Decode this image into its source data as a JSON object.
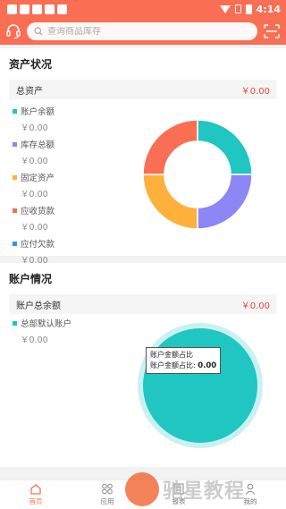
{
  "status": {
    "time": "4:14"
  },
  "search": {
    "placeholder": "查询商品库存"
  },
  "assets": {
    "title": "资产状况",
    "total_label": "总资产",
    "total_value": "￥0.00",
    "items": [
      {
        "label": "账户余额",
        "value": "￥0.00",
        "color": "#1fc6c2"
      },
      {
        "label": "库存总额",
        "value": "￥0.00",
        "color": "#8c87f5"
      },
      {
        "label": "固定资产",
        "value": "￥0.00",
        "color": "#fdb13a"
      },
      {
        "label": "应收货款",
        "value": "￥0.00",
        "color": "#fa6e53"
      },
      {
        "label": "应付欠款",
        "value": "￥0.00",
        "color": "#3b8fe5"
      }
    ]
  },
  "accounts": {
    "title": "账户情况",
    "total_label": "账户总余额",
    "total_value": "￥0.00",
    "items": [
      {
        "label": "总部默认账户",
        "value": "￥0.00",
        "color": "#1fc6c2"
      }
    ],
    "tooltip": {
      "title": "账户金额占比",
      "label": "账户金额占比:",
      "value": "0.00"
    }
  },
  "chart_data": [
    {
      "type": "pie",
      "categories": [
        "账户余额",
        "库存总额",
        "固定资产",
        "应收货款"
      ],
      "values": [
        25,
        25,
        25,
        25
      ],
      "colors": [
        "#1fc6c2",
        "#8c87f5",
        "#fdb13a",
        "#fa6e53"
      ]
    },
    {
      "type": "pie",
      "categories": [
        "总部默认账户"
      ],
      "values": [
        100
      ],
      "colors": [
        "#1fc6c2"
      ]
    }
  ],
  "nav": {
    "items": [
      {
        "label": "首页"
      },
      {
        "label": "应用"
      },
      {
        "label": "报表"
      },
      {
        "label": "我的"
      }
    ]
  },
  "watermark": {
    "text": "驰星教程"
  }
}
